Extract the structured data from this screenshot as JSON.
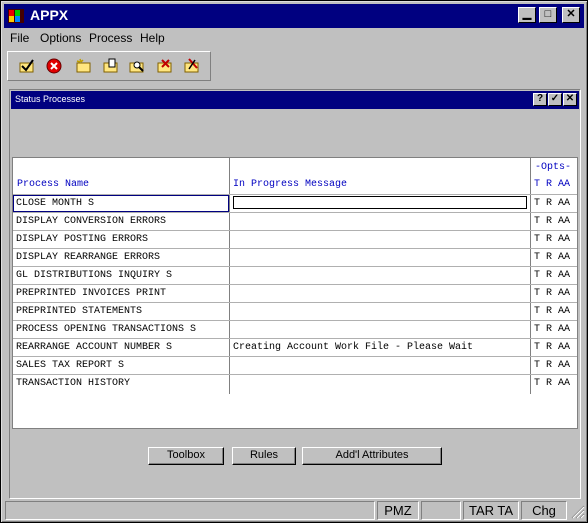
{
  "app": {
    "title": "APPX"
  },
  "window_buttons": {
    "minimize": "▁",
    "maximize": "□",
    "close": "✕"
  },
  "menu": {
    "items": [
      "File",
      "Options",
      "Process",
      "Help"
    ]
  },
  "toolbar": {
    "icons": [
      "check-folder-icon",
      "cancel-icon",
      "new-folder-icon",
      "edit-folder-icon",
      "search-folder-icon",
      "delete-folder-icon",
      "tools-folder-icon"
    ]
  },
  "child_window": {
    "title": "Status Processes",
    "buttons": {
      "help": "?",
      "ok": "✓",
      "close": "✕"
    }
  },
  "grid": {
    "headers": {
      "process_name": "Process Name",
      "message": "In Progress Message",
      "opts_group": "-Opts-",
      "opts": "T R AA"
    },
    "rows": [
      {
        "name": "CLOSE MONTH S",
        "message": "",
        "opts": "T R AA"
      },
      {
        "name": "DISPLAY CONVERSION ERRORS",
        "message": "",
        "opts": "T R AA"
      },
      {
        "name": "DISPLAY POSTING ERRORS",
        "message": "",
        "opts": "T R AA"
      },
      {
        "name": "DISPLAY REARRANGE ERRORS",
        "message": "",
        "opts": "T R AA"
      },
      {
        "name": "GL DISTRIBUTIONS INQUIRY S",
        "message": "",
        "opts": "T R AA"
      },
      {
        "name": "PREPRINTED INVOICES PRINT",
        "message": "",
        "opts": "T R AA"
      },
      {
        "name": "PREPRINTED STATEMENTS",
        "message": "",
        "opts": "T R AA"
      },
      {
        "name": "PROCESS OPENING TRANSACTIONS S",
        "message": "",
        "opts": "T R AA"
      },
      {
        "name": "REARRANGE ACCOUNT NUMBER S",
        "message": "Creating Account Work File - Please Wait",
        "opts": "T R AA"
      },
      {
        "name": "SALES TAX REPORT S",
        "message": "",
        "opts": "T R AA"
      },
      {
        "name": "TRANSACTION HISTORY",
        "message": "",
        "opts": "T R AA"
      }
    ]
  },
  "buttons": {
    "toolbox": "Toolbox",
    "rules": "Rules",
    "addl": "Add'l Attributes"
  },
  "statusbar": {
    "pmz": "PMZ",
    "tar": "TAR TA",
    "chg": "Chg"
  }
}
